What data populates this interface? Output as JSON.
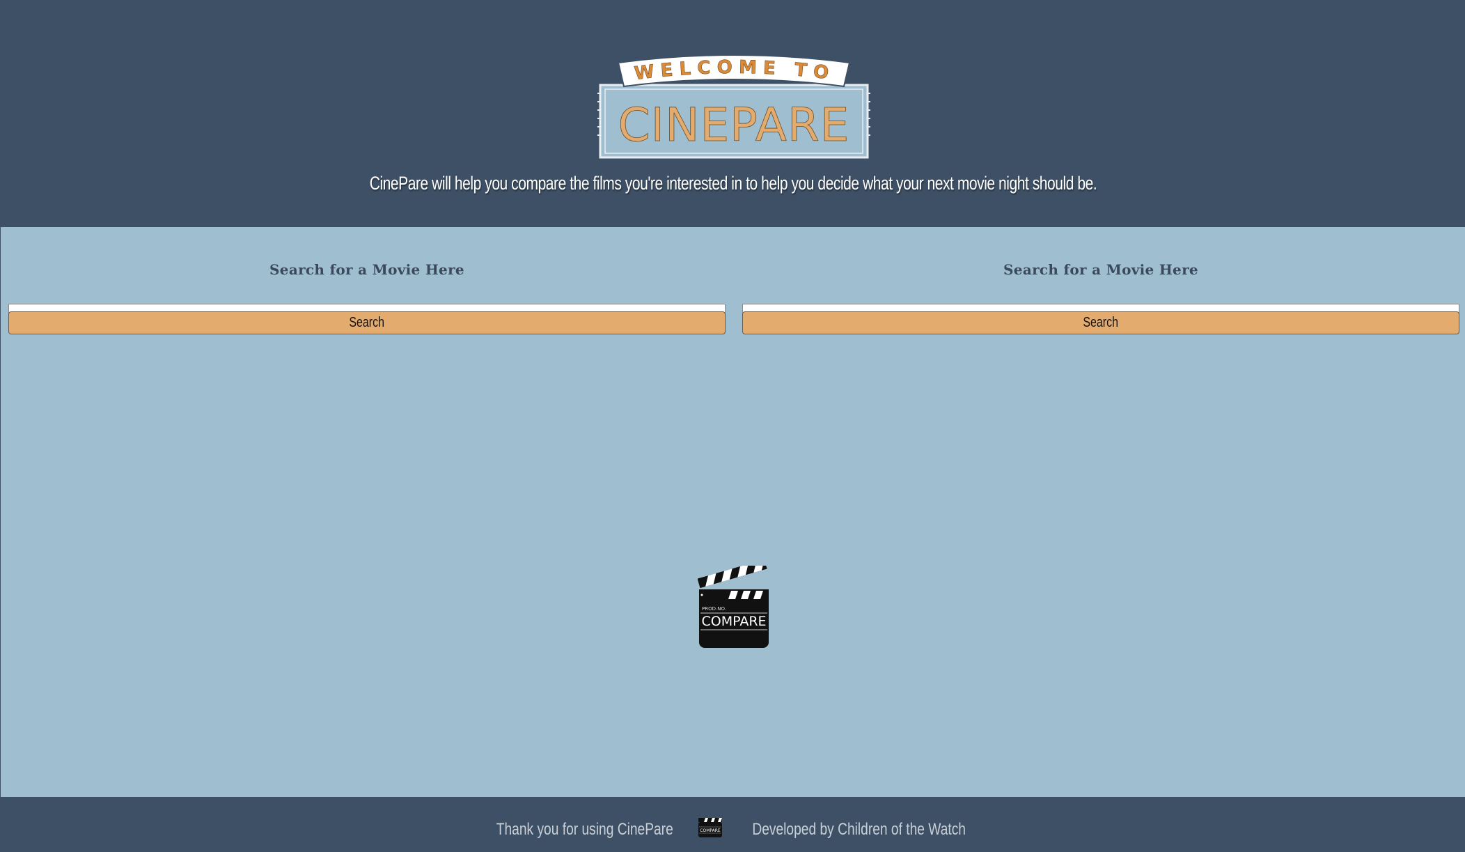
{
  "header": {
    "logo_top_text": "WELCOME TO",
    "logo_main_text": "CINEPARE",
    "tagline": "CinePare will help you compare the films you're interested in to help you decide what your next movie night should be."
  },
  "search": [
    {
      "heading": "Search for a Movie Here",
      "input_value": "",
      "button_label": "Search"
    },
    {
      "heading": "Search for a Movie Here",
      "input_value": "",
      "button_label": "Search"
    }
  ],
  "center_icon": {
    "icon": "clapperboard-icon",
    "small_text": "PROD.NO.",
    "main_text": "COMPARE"
  },
  "footer": {
    "thanks_text": "Thank you for using CinePare",
    "icon": "clapperboard-icon",
    "developed_text": "Developed by Children of the Watch"
  },
  "colors": {
    "header_bg": "#3e5065",
    "body_bg": "#9fbfd0",
    "accent": "#e4ab6f"
  }
}
